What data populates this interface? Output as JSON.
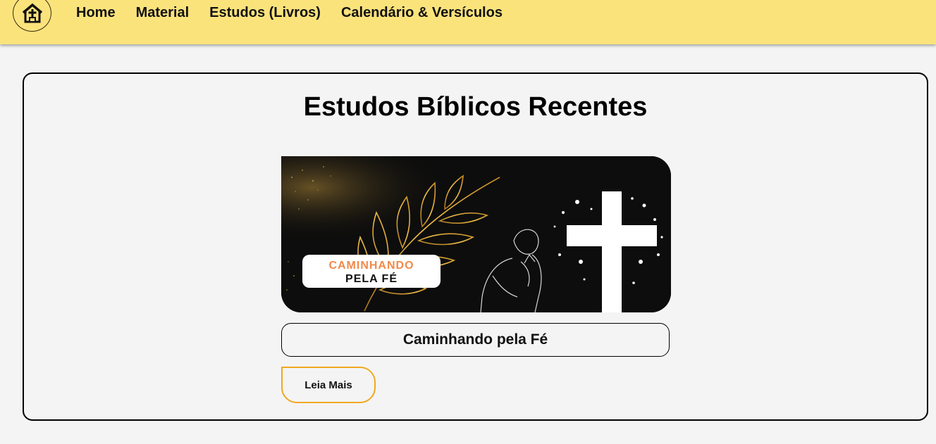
{
  "nav": {
    "logo_icon": "church-icon",
    "links": [
      "Home",
      "Material",
      "Estudos (Livros)",
      "Calendário & Versículos"
    ]
  },
  "main": {
    "title": "Estudos Bíblicos Recentes",
    "study": {
      "image_badge_line1": "CAMINHANDO",
      "image_badge_line2": "PELA FÉ",
      "title": "Caminhando pela Fé",
      "button_label": "Leia Mais"
    }
  },
  "colors": {
    "navbar": "#fbe37c",
    "button_border": "#f0a820",
    "badge_accent": "#f08a4b"
  }
}
